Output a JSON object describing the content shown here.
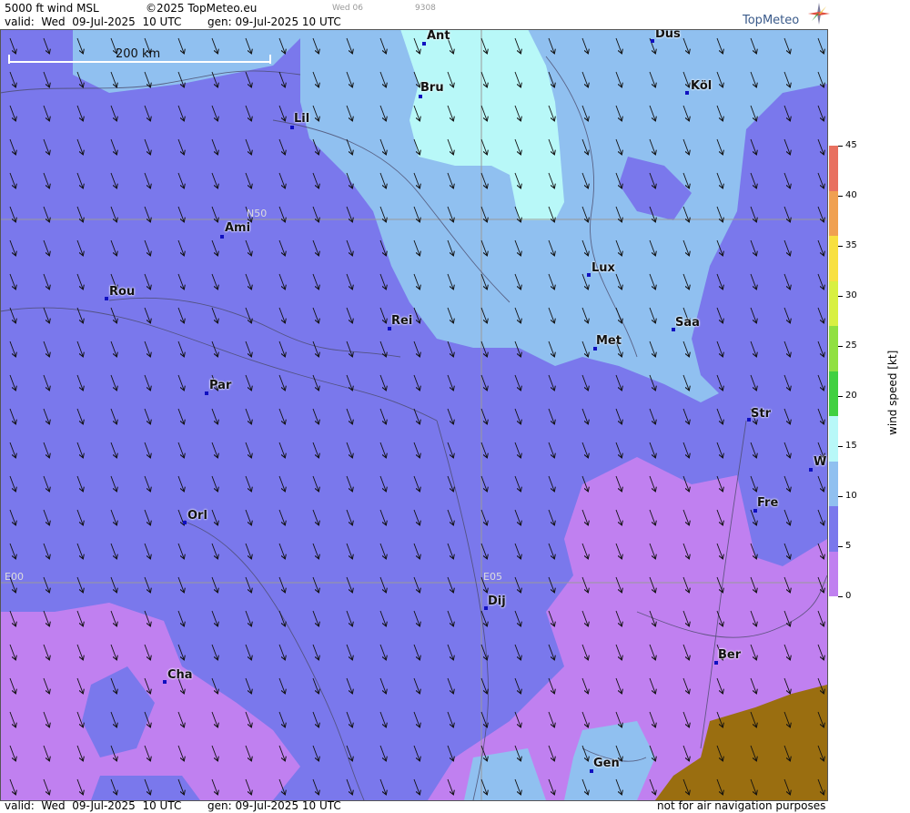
{
  "header": {
    "product": "5000 ft wind MSL",
    "copyright": "©2025 TopMeteo.eu",
    "small_day": "Wed 06",
    "small_code": "9308",
    "valid": "valid:  Wed  09-Jul-2025  10 UTC",
    "generated": "gen: 09-Jul-2025 10 UTC",
    "logo_text": "TopMeteo"
  },
  "map": {
    "scale_label": "200 km",
    "grid_labels": {
      "lat": "N50",
      "lon1": "E00",
      "lon2": "E05"
    },
    "cities": [
      {
        "name": "Ant"
      },
      {
        "name": "Düs"
      },
      {
        "name": "Bru"
      },
      {
        "name": "Köl"
      },
      {
        "name": "Lil"
      },
      {
        "name": "Ami"
      },
      {
        "name": "Rou"
      },
      {
        "name": "Lux"
      },
      {
        "name": "Rei"
      },
      {
        "name": "Saa"
      },
      {
        "name": "Met"
      },
      {
        "name": "Par"
      },
      {
        "name": "Str"
      },
      {
        "name": "W"
      },
      {
        "name": "Fre"
      },
      {
        "name": "Orl"
      },
      {
        "name": "Dij"
      },
      {
        "name": "Ber"
      },
      {
        "name": "Cha"
      },
      {
        "name": "Gen"
      }
    ],
    "wind_direction": "north-northwest"
  },
  "colorbar": {
    "title": "wind speed [kt]",
    "ticks": [
      "45",
      "40",
      "35",
      "30",
      "25",
      "20",
      "15",
      "10",
      "5",
      "0"
    ],
    "colors": [
      "#e87060",
      "#f0a050",
      "#f8e040",
      "#d8f040",
      "#90e040",
      "#40d040",
      "#b8f8f8",
      "#90c0f0",
      "#7a78ec",
      "#c080f0"
    ]
  },
  "footer": {
    "valid": "valid:  Wed  09-Jul-2025  10 UTC",
    "generated": "gen: 09-Jul-2025 10 UTC",
    "disclaimer": "not for air navigation purposes"
  }
}
